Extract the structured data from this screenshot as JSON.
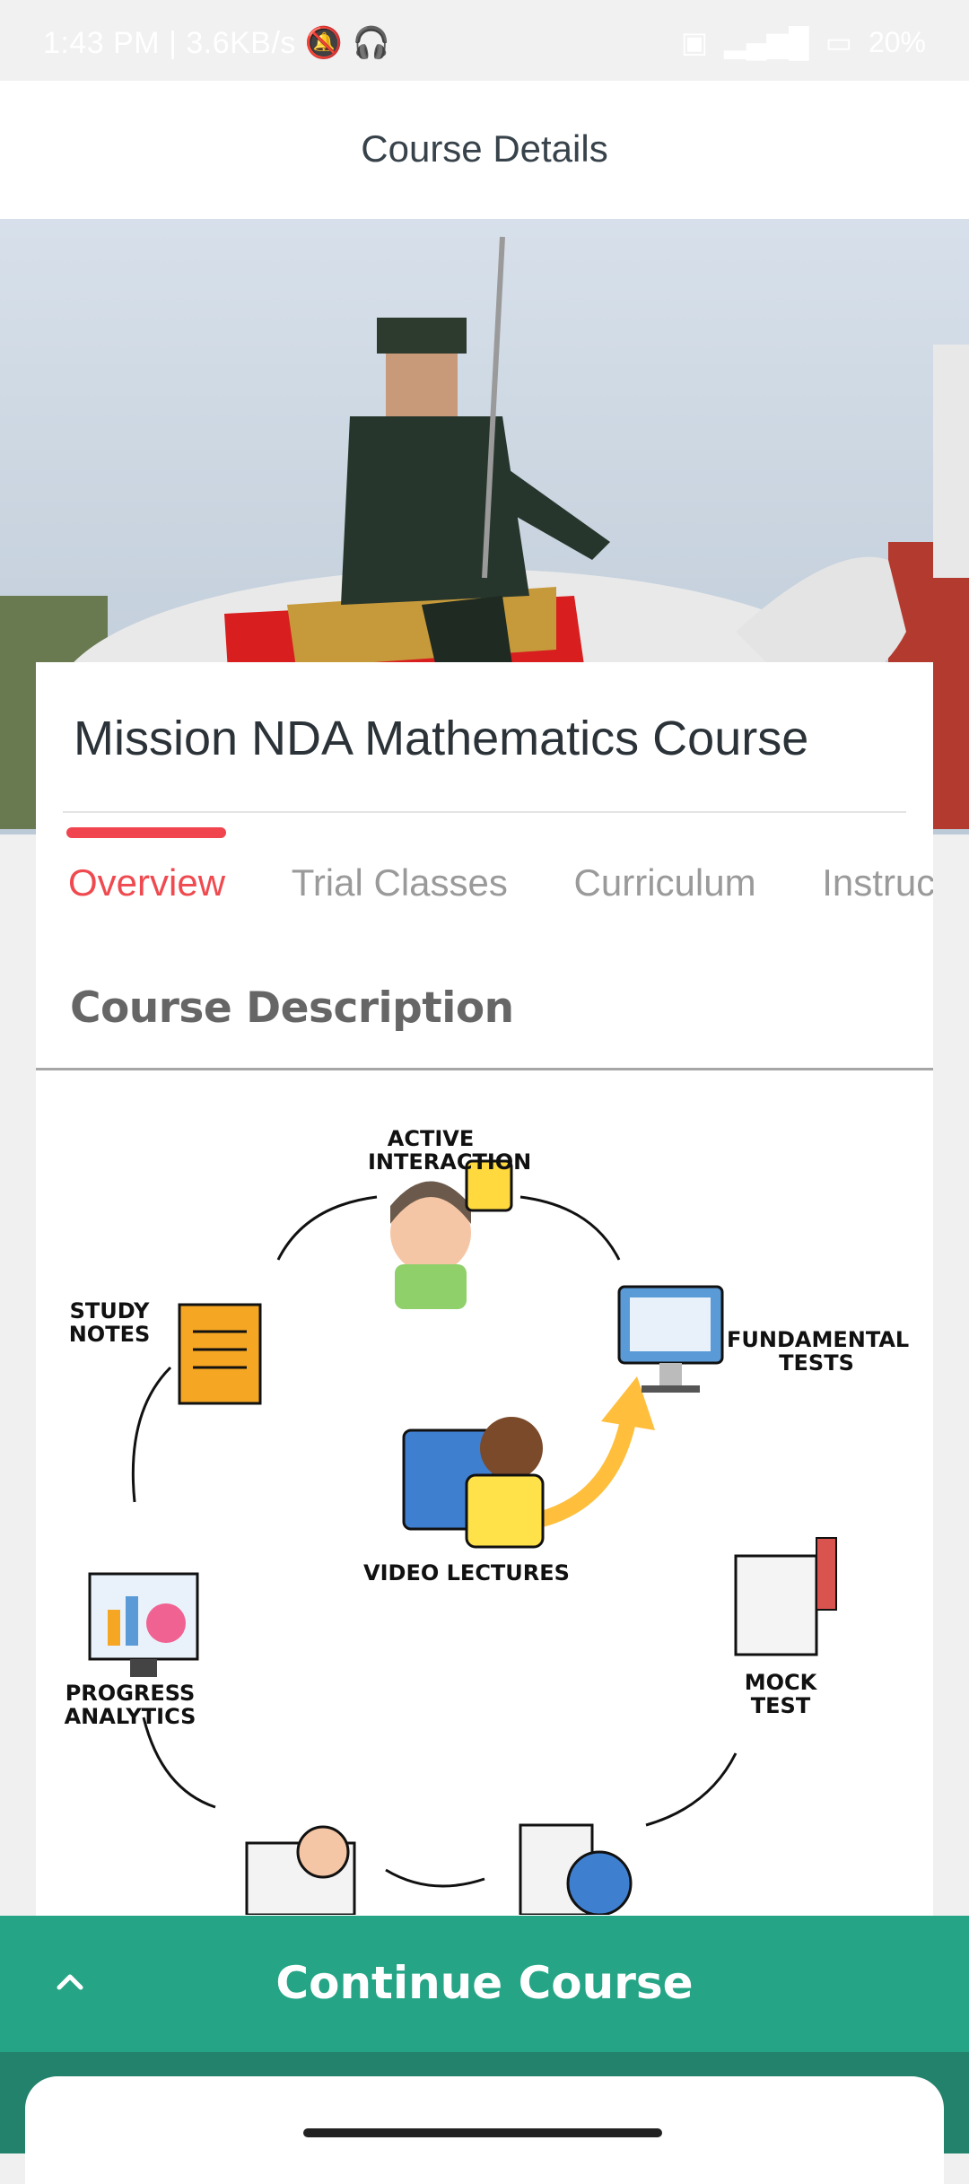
{
  "status_bar": {
    "time": "1:43 PM",
    "speed": "3.6KB/s",
    "battery": "20%",
    "icons": [
      "mute-icon",
      "headphones-icon",
      "sim-icon",
      "signal-icon",
      "battery-icon"
    ]
  },
  "header": {
    "title": "Course Details"
  },
  "course": {
    "title": "Mission NDA Mathematics Course"
  },
  "tabs": [
    "Overview",
    "Trial Classes",
    "Curriculum",
    "Instructors"
  ],
  "active_tab": "Overview",
  "section": {
    "title": "Course Description"
  },
  "illustration": {
    "labels": {
      "active_interaction": "ACTIVE\nINTERACTION",
      "study_notes": "STUDY\nNOTES",
      "fundamental_tests": "FUNDAMENTAL\nTESTS",
      "video_lectures": "VIDEO LECTURES",
      "progress_analytics": "PROGRESS\nANALYTICS",
      "mock_test": "MOCK\nTEST"
    }
  },
  "cta": {
    "label": "Continue Course"
  },
  "colors": {
    "accent": "#ef4a4f",
    "cta": "#25a586"
  }
}
